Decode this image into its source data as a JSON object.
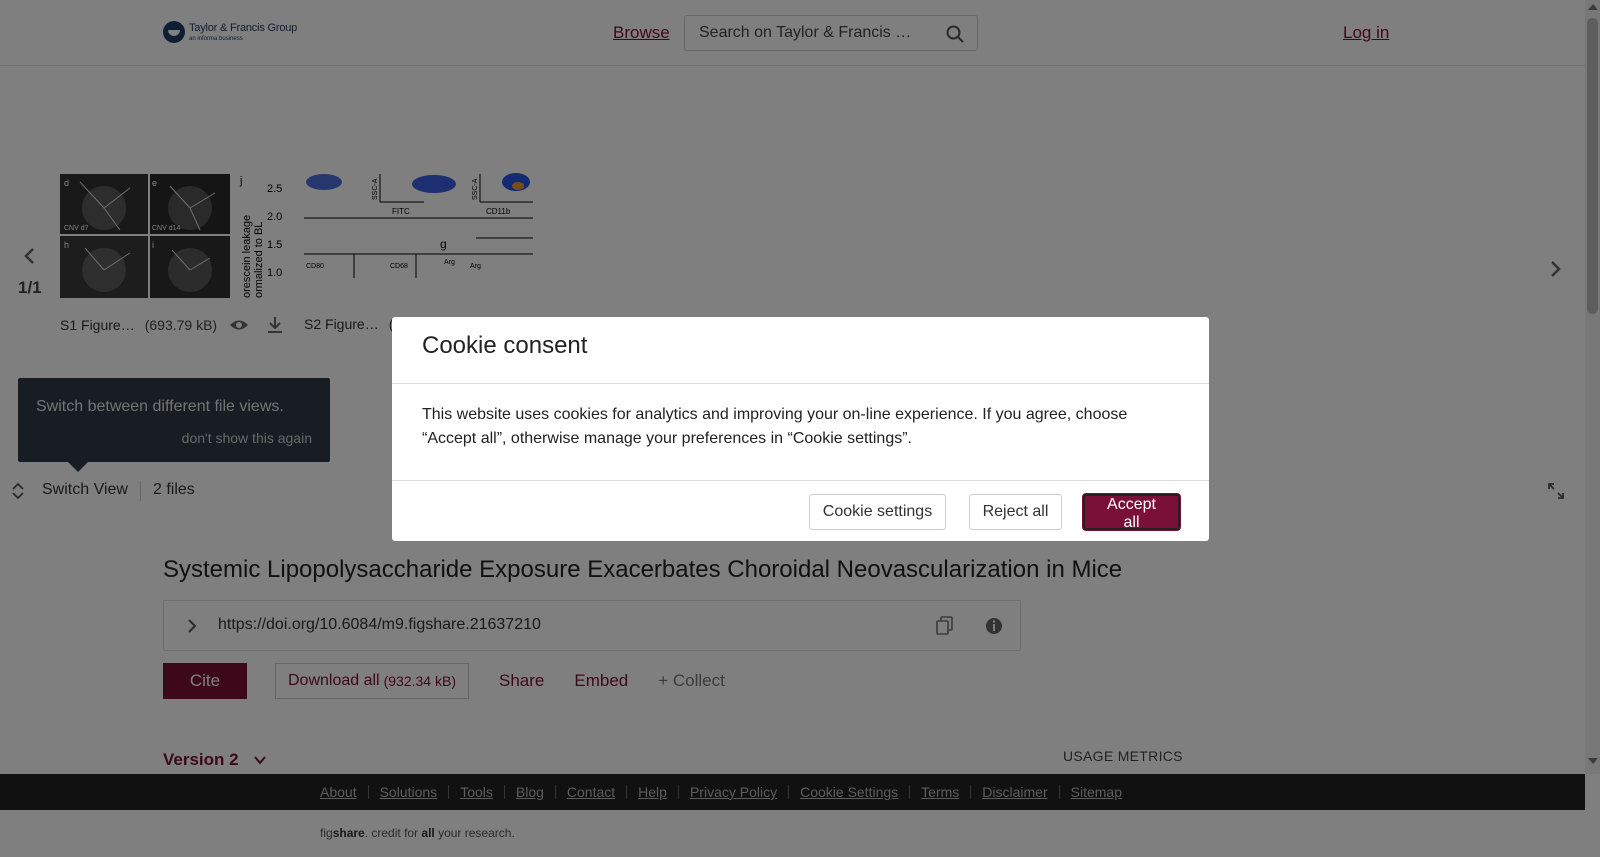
{
  "header": {
    "logo_name": "Taylor & Francis Group",
    "logo_sub": "an informa business",
    "browse": "Browse",
    "search_placeholder": "Search on Taylor & Francis …",
    "login": "Log in"
  },
  "viewer": {
    "pager": "1/1",
    "files": [
      {
        "name": "S1 Figure…",
        "size": "(693.79 kB)"
      },
      {
        "name": "S2 Figure…",
        "size": "("
      }
    ],
    "tooltip": {
      "text": "Switch between different file views.",
      "dismiss": "don't show this again"
    },
    "switch_view": "Switch View",
    "file_count": "2 files"
  },
  "article": {
    "title": "Systemic Lipopolysaccharide Exposure Exacerbates Choroidal Neovascularization in Mice",
    "doi": "https://doi.org/10.6084/m9.figshare.21637210",
    "cite": "Cite",
    "download_all": "Download all",
    "download_size": "(932.34 kB)",
    "share": "Share",
    "embed": "Embed",
    "collect": "+ Collect",
    "version": "Version 2",
    "usage_metrics": "USAGE METRICS"
  },
  "footer": {
    "links": [
      "About",
      "Solutions",
      "Tools",
      "Blog",
      "Contact",
      "Help",
      "Privacy Policy",
      "Cookie Settings",
      "Terms",
      "Disclaimer",
      "Sitemap"
    ],
    "tagline_pre": "fig",
    "tagline_brand": "share",
    "tagline_mid": ". credit for ",
    "tagline_all": "all",
    "tagline_end": " your research."
  },
  "cookie": {
    "title": "Cookie consent",
    "body": "This website uses cookies for analytics and improving your on-line experience. If you agree, choose “Accept all”, otherwise manage your preferences in “Cookie settings”.",
    "settings": "Cookie settings",
    "reject": "Reject all",
    "accept": "Accept all"
  },
  "colors": {
    "brand": "#7a1035",
    "footer_bg": "#222222",
    "tooltip_bg": "#2e3a46"
  }
}
